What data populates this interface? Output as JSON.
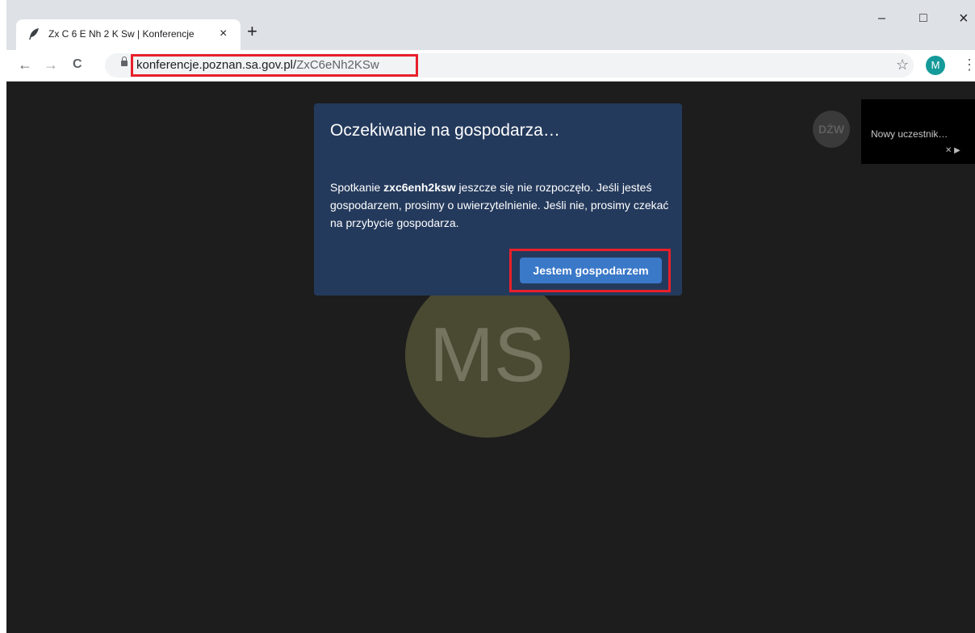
{
  "browser": {
    "tab_title": "Zx C 6 E Nh 2 K Sw | Konferencje",
    "tab_close": "×",
    "new_tab": "+",
    "minimize": "–",
    "maximize": "□",
    "close": "×",
    "back": "←",
    "forward": "→",
    "reload": "C",
    "url_domain": "konferencje.poznan.sa.gov.pl/",
    "url_path": "ZxC6eNh2KSw",
    "star": "☆",
    "profile_initial": "M",
    "menu": "⋮"
  },
  "meeting": {
    "main_avatar_initials": "MS",
    "participant_avatar_initials": "DŻW",
    "participant_tile_name": "Nowy uczestnik…",
    "tile_icons": "✕ ▶"
  },
  "dialog": {
    "title": "Oczekiwanie na gospodarza…",
    "body_prefix": "Spotkanie ",
    "meeting_name": "zxc6enh2ksw",
    "body_suffix": " jeszcze się nie rozpoczęło. Jeśli jesteś gospodarzem, prosimy o uwierzytelnienie. Jeśli nie, prosimy czekać na przybycie gospodarza.",
    "host_button": "Jestem gospodarzem"
  },
  "colors": {
    "dialog_bg": "#243a5c",
    "button_bg": "#3a78c8",
    "highlight": "#e8202a",
    "stage_bg": "#1d1d1d"
  }
}
